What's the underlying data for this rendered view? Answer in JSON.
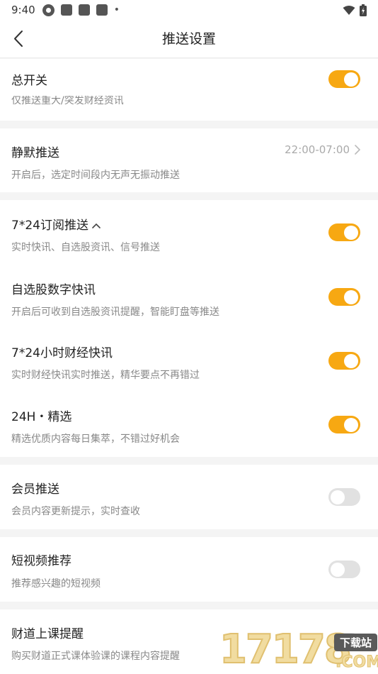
{
  "status_bar": {
    "time": "9:40",
    "icons": [
      "vpn-icon",
      "notification-icon",
      "notification-icon",
      "notification-icon",
      "more-dot-icon",
      "wifi-icon",
      "battery-icon"
    ]
  },
  "nav": {
    "title": "推送设置",
    "back_icon": "chevron-left-icon"
  },
  "settings": {
    "master": {
      "title": "总开关",
      "subtitle": "仅推送重大/突发财经资讯",
      "enabled": true
    },
    "quiet": {
      "title": "静默推送",
      "subtitle": "开启后，选定时间段内无声无振动推送",
      "value": "22:00-07:00"
    },
    "subscription": {
      "title": "7*24订阅推送",
      "subtitle": "实时快讯、自选股资讯、信号推送",
      "enabled": true,
      "expanded": true
    },
    "watchlist": {
      "title": "自选股数字快讯",
      "subtitle": "开启后可收到自选股资讯提醒，智能盯盘等推送",
      "enabled": true
    },
    "flash": {
      "title": "7*24小时财经快讯",
      "subtitle": "实时财经快讯实时推送，精华要点不再错过",
      "enabled": true
    },
    "featured": {
      "title": "24H・精选",
      "subtitle": "精选优质内容每日集萃，不错过好机会",
      "enabled": true
    },
    "member": {
      "title": "会员推送",
      "subtitle": "会员内容更新提示，实时查收",
      "enabled": false
    },
    "video": {
      "title": "短视频推荐",
      "subtitle": "推荐感兴趣的短视频",
      "enabled": false
    },
    "course": {
      "title": "财道上课提醒",
      "subtitle": "购买财道正式课体验课的课程内容提醒",
      "enabled": false
    }
  },
  "watermark": {
    "digits": "17178",
    "badge": "下载站",
    "suffix": ".COM"
  },
  "colors": {
    "accent": "#f7a812",
    "toggle_off": "#e1e1e1",
    "background": "#f4f4f4"
  }
}
